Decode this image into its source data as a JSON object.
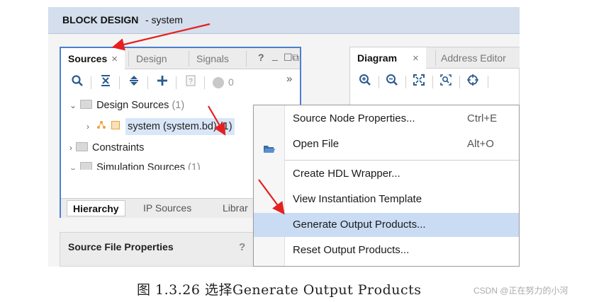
{
  "header": {
    "bold": "BLOCK DESIGN",
    "name": " - system"
  },
  "sources_panel": {
    "tabs": [
      "Sources",
      "Design",
      "Signals"
    ],
    "tab_close": "×",
    "win_controls": [
      "?",
      "_",
      "☐",
      "⧉"
    ],
    "toolbar": {
      "more": "»",
      "status_count": "0"
    },
    "tree": [
      {
        "label": "Design Sources",
        "count": "(1)"
      },
      {
        "label": "system (system.bd) (1)"
      },
      {
        "label": "Constraints"
      },
      {
        "label": "Simulation Sources",
        "count": "(1)"
      }
    ],
    "bottom_tabs": [
      "Hierarchy",
      "IP Sources",
      "Librar"
    ]
  },
  "source_file_properties": {
    "title": "Source File Properties",
    "help": "?"
  },
  "diagram_panel": {
    "tabs": [
      "Diagram",
      "Address Editor"
    ],
    "tab_close": "×"
  },
  "context_menu": {
    "items": [
      {
        "label": "Source Node Properties...",
        "shortcut": "Ctrl+E"
      },
      {
        "label": "Open File",
        "shortcut": "Alt+O"
      },
      {
        "label": "Create HDL Wrapper..."
      },
      {
        "label": "View Instantiation Template"
      },
      {
        "label": "Generate Output Products..."
      },
      {
        "label": "Reset Output Products..."
      }
    ]
  },
  "caption": "图 1.3.26 选择Generate Output Products",
  "watermark": "CSDN @正在努力的小河",
  "colors": {
    "accent": "#4a7fd1",
    "header_bg": "#d4deec",
    "menu_highlight": "#c9dcf3",
    "selection": "#d8e6f7",
    "arrow": "#e52020"
  }
}
